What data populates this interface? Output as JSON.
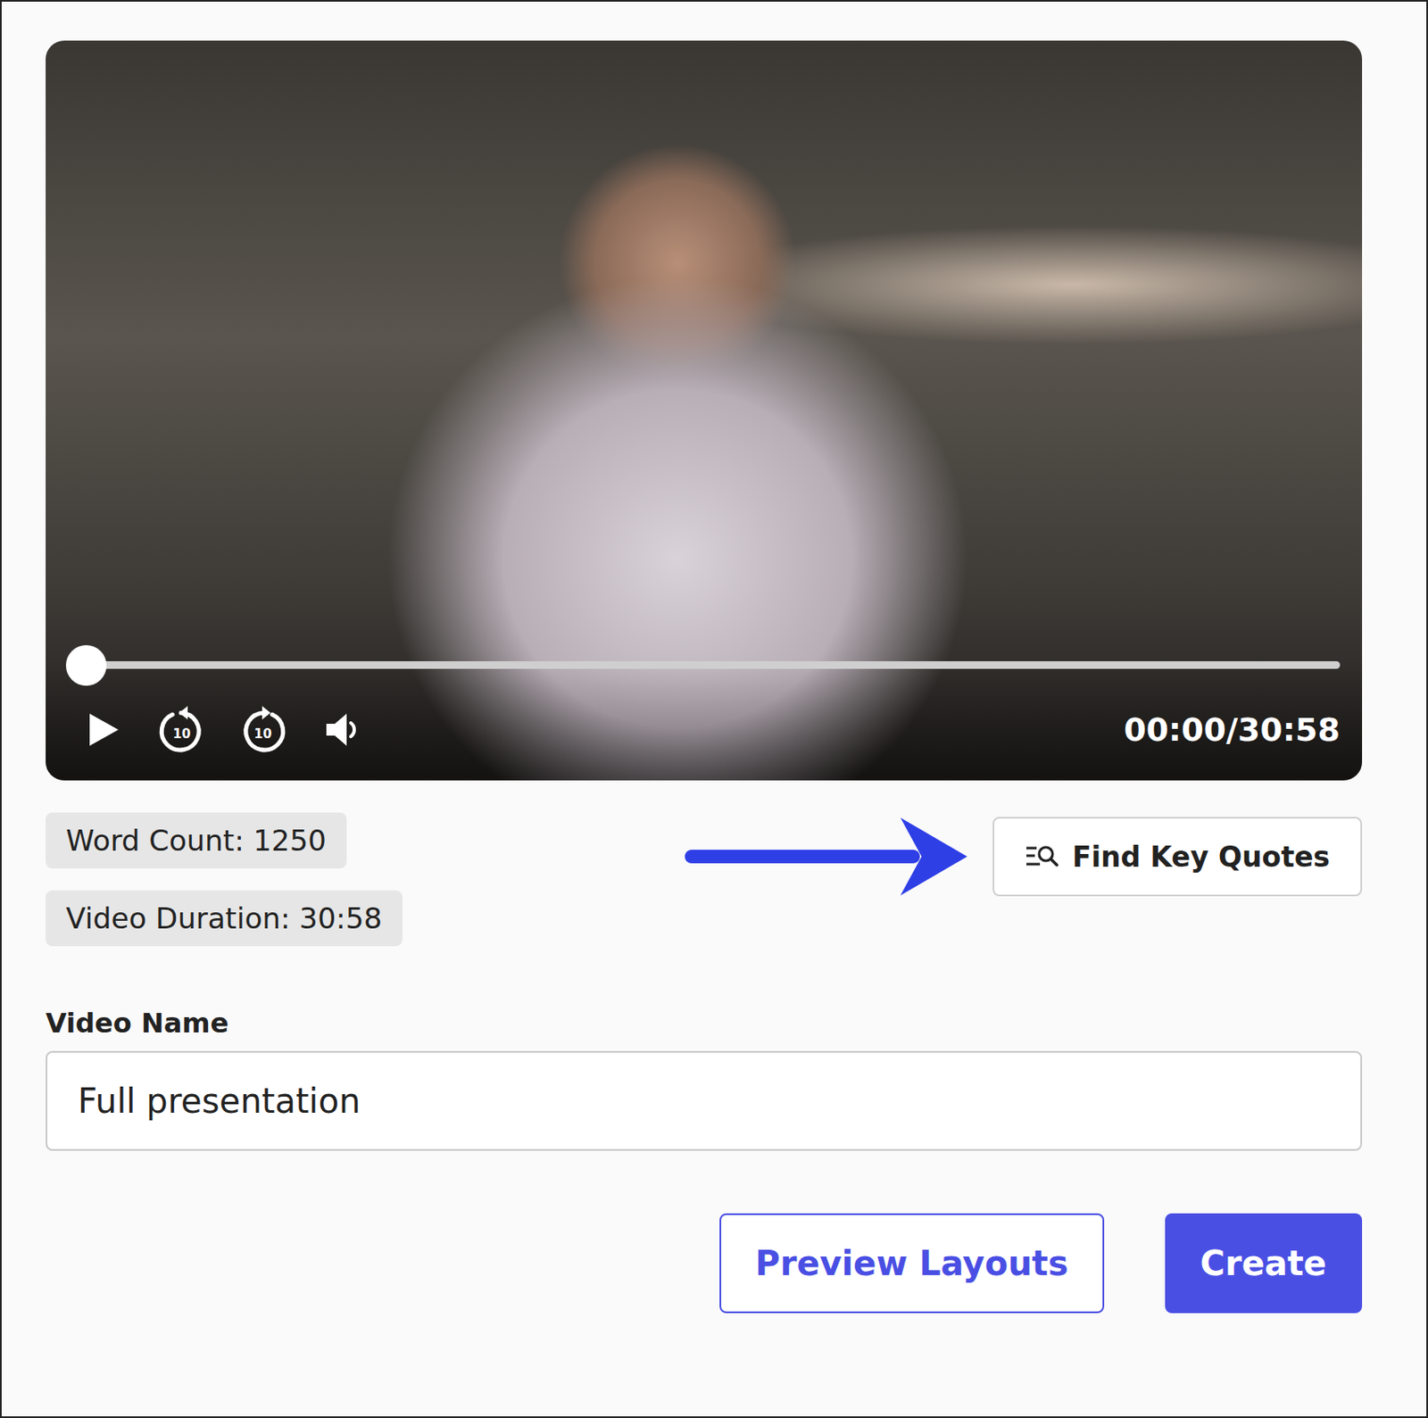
{
  "video": {
    "time": "00:00/30:58",
    "level": 0,
    "skip_back_label": "10",
    "skip_forward_label": "10"
  },
  "stats": [
    "Word Count: 1250",
    "Video Duration: 30:58"
  ],
  "find_button": {
    "label": "Find Key Quotes"
  },
  "name_field": {
    "label": "Video Name",
    "value": "Full presentation"
  },
  "buttons": [
    {
      "label": "Preview Layouts",
      "kind": "outline"
    },
    {
      "label": "Create",
      "kind": "primary"
    }
  ]
}
